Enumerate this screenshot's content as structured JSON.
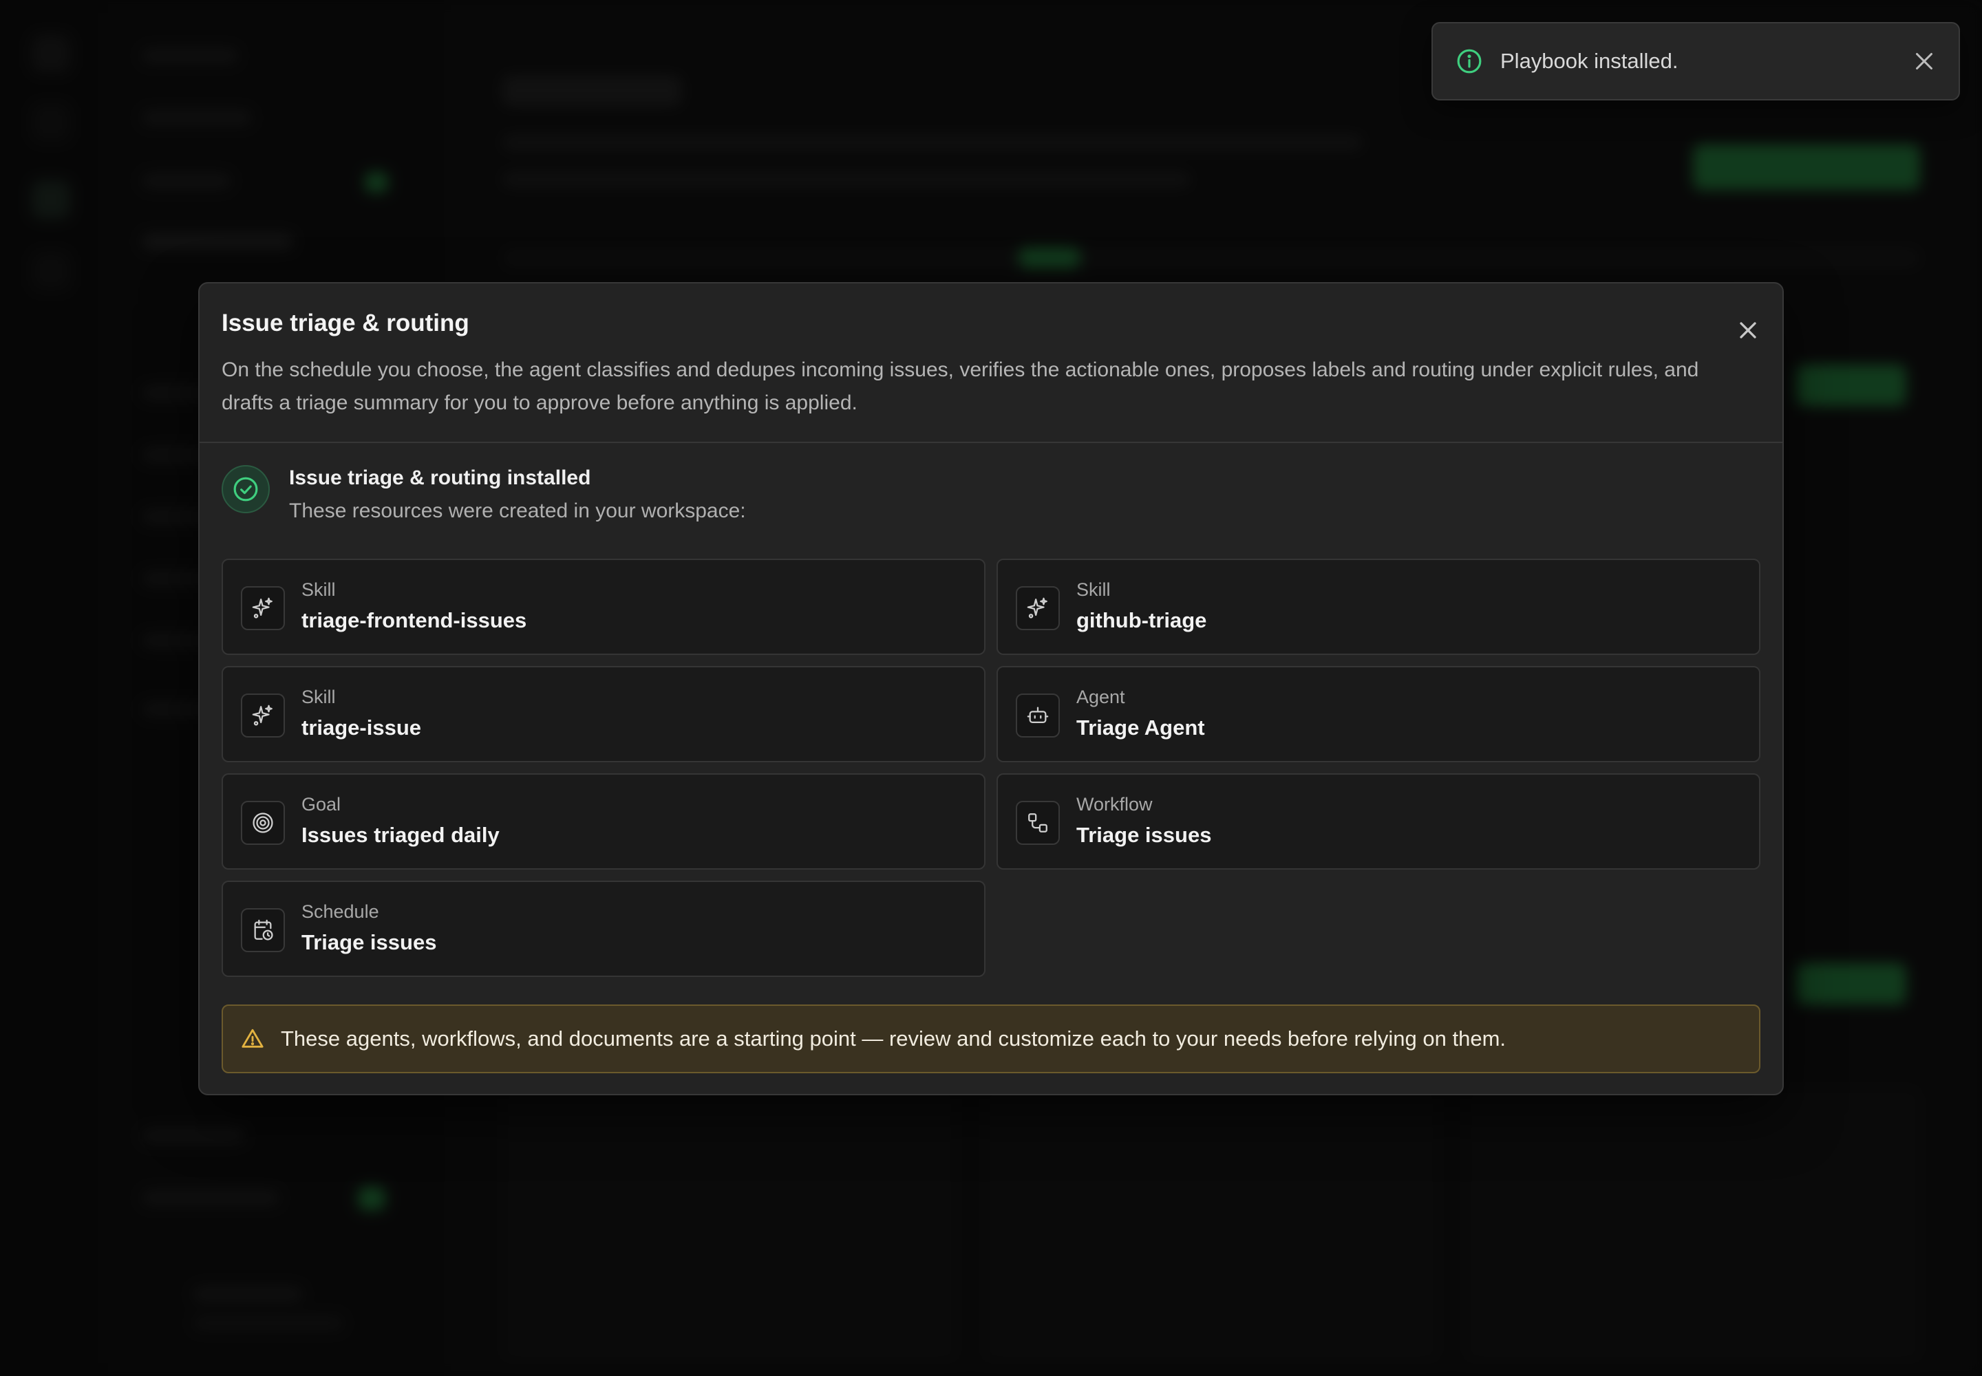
{
  "toast": {
    "message": "Playbook installed."
  },
  "modal": {
    "title": "Issue triage & routing",
    "description": "On the schedule you choose, the agent classifies and dedupes incoming issues, verifies the actionable ones, proposes labels and routing under explicit rules, and drafts a triage summary for you to approve before anything is applied.",
    "success_title": "Issue triage & routing installed",
    "success_subtitle": "These resources were created in your workspace:",
    "resources": [
      {
        "type": "Skill",
        "name": "triage-frontend-issues",
        "icon": "sparkle-icon"
      },
      {
        "type": "Skill",
        "name": "github-triage",
        "icon": "sparkle-icon"
      },
      {
        "type": "Skill",
        "name": "triage-issue",
        "icon": "sparkle-icon"
      },
      {
        "type": "Agent",
        "name": "Triage Agent",
        "icon": "robot-icon"
      },
      {
        "type": "Goal",
        "name": "Issues triaged daily",
        "icon": "target-icon"
      },
      {
        "type": "Workflow",
        "name": "Triage issues",
        "icon": "workflow-icon"
      },
      {
        "type": "Schedule",
        "name": "Triage issues",
        "icon": "calendar-clock-icon"
      }
    ],
    "warning": "These agents, workflows, and documents are a starting point — review and customize each to your needs before relying on them."
  },
  "colors": {
    "success": "#3fcf7f",
    "warning": "#e3b341",
    "surface": "#232323",
    "card": "#1a1a1a"
  }
}
